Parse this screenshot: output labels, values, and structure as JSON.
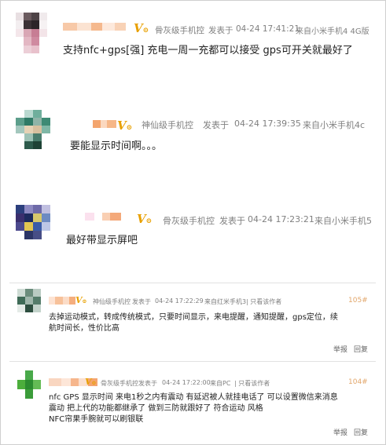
{
  "comments": [
    {
      "user_level": "骨灰级手机控",
      "posted_label": "发表于",
      "time": "04-24 17:41:21",
      "source": "来自小米手机4 4G版",
      "text": "支持nfc+gps[强] 充电一周一充都可以接受 gps可开关就最好了"
    },
    {
      "user_level": "神仙级手机控",
      "posted_label": "发表于",
      "time": "04-24 17:39:35",
      "source": "来自小米手机4c",
      "text": "要能显示时间啊。。。"
    },
    {
      "user_level": "骨灰级手机控",
      "posted_label": "发表于",
      "time": "04-24 17:23:21",
      "source": "来自小米手机5",
      "text": "最好带显示屏吧"
    },
    {
      "user_level": "神仙级手机控",
      "posted_label": "发表于",
      "time": "04-24 17:22:29",
      "source": "来自红米手机3",
      "extra": "| 只看该作者",
      "floor": "105#",
      "text_lines": [
        "去掉运动模式，转成传统模式，只要时间显示，来电提醒，通知提醒，gps定位，续",
        "航时间长，性价比高"
      ],
      "report": "举报",
      "reply": "回复"
    },
    {
      "user_level": "骨灰级手机控",
      "posted_label": "发表于",
      "time": "04-24 17:22:00",
      "source": "来自PC",
      "extra": "| 只看该作者",
      "floor": "104#",
      "text_lines": [
        "nfc  GPS  显示时间  来电1秒之内有震动 有延迟被人就挂电话了 可以设置微信来消息",
        "震动  把上代的功能都继承了  做到三防就跟好了  符合运动 风格",
        "NFC帘果手腕就可以刷银联"
      ],
      "report": "举报",
      "reply": "回复"
    }
  ],
  "colors": {
    "vip": "#e8a000",
    "meta": "#808080",
    "text": "#222222",
    "extra": "#e2a66a"
  },
  "badge_icon": "vip-v-icon"
}
